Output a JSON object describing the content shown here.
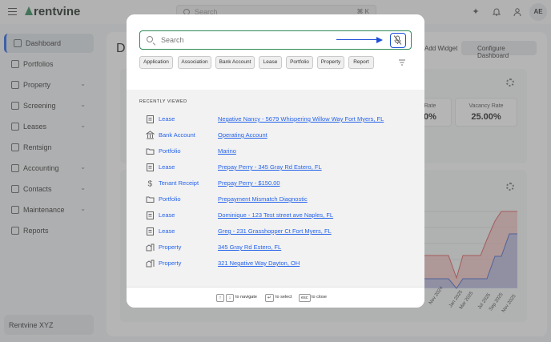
{
  "app": {
    "brand": "rentvine",
    "top_search": {
      "placeholder": "Search",
      "shortcut": "⌘ K"
    },
    "avatar_initials": "AE",
    "accent_color": "#2563eb",
    "brand_color": "#2e8b57"
  },
  "sidebar": {
    "items": [
      {
        "label": "Dashboard",
        "icon": "dashboard-icon",
        "active": true
      },
      {
        "label": "Portfolios",
        "icon": "folder-icon"
      },
      {
        "label": "Property",
        "icon": "building-icon",
        "expandable": true
      },
      {
        "label": "Screening",
        "icon": "clipboard-icon",
        "expandable": true
      },
      {
        "label": "Leases",
        "icon": "document-icon",
        "expandable": true
      },
      {
        "label": "Rentsign",
        "icon": "signature-icon"
      },
      {
        "label": "Accounting",
        "icon": "dollar-icon",
        "expandable": true
      },
      {
        "label": "Contacts",
        "icon": "book-icon",
        "expandable": true
      },
      {
        "label": "Maintenance",
        "icon": "wrench-icon",
        "expandable": true
      },
      {
        "label": "Reports",
        "icon": "chart-icon"
      }
    ],
    "workspace": "Rentvine XYZ"
  },
  "dashboard": {
    "title": "D",
    "add_widget": "Add Widget",
    "configure": "Configure Dashboard",
    "rate_label": "Rate",
    "rate_value": "0%",
    "vacancy_label": "Vacancy Rate",
    "vacancy_value": "25.00%",
    "month_labels": [
      "Nov 2024",
      "Jan 2025",
      "Mar 2025",
      "Jul 2025",
      "Sep 2025",
      "Nov 2025"
    ]
  },
  "modal": {
    "search_placeholder": "Search",
    "filters": [
      "Application",
      "Association",
      "Bank Account",
      "Lease",
      "Portfolio",
      "Property",
      "Report"
    ],
    "recent_header": "RECENTLY VIEWED",
    "recent": [
      {
        "type": "Lease",
        "icon": "clipboard-icon",
        "name": "Negative Nancy - 5679 Whispering Willow Way Fort Myers, FL"
      },
      {
        "type": "Bank Account",
        "icon": "bank-icon",
        "name": "Operating Account"
      },
      {
        "type": "Portfolio",
        "icon": "folder-icon",
        "name": "Marino"
      },
      {
        "type": "Lease",
        "icon": "clipboard-icon",
        "name": "Prepay Perry - 345 Gray Rd Estero, FL"
      },
      {
        "type": "Tenant Receipt",
        "icon": "dollar-icon",
        "name": "Prepay Perry - $150.00"
      },
      {
        "type": "Portfolio",
        "icon": "folder-icon",
        "name": "Prepayment Mismatch Diagnostic"
      },
      {
        "type": "Lease",
        "icon": "clipboard-icon",
        "name": "Dominique - 123 Test street ave Naples, FL"
      },
      {
        "type": "Lease",
        "icon": "clipboard-icon",
        "name": "Greg - 231 Grasshopper Ct Fort Myers, FL"
      },
      {
        "type": "Property",
        "icon": "building-icon",
        "name": "345 Gray Rd Estero, FL"
      },
      {
        "type": "Property",
        "icon": "building-icon",
        "name": "321 Negative Way Dayton, OH"
      }
    ],
    "footer": {
      "up_key": "↑",
      "down_key": "↓",
      "navigate": "to navigate",
      "enter_key": "↵",
      "select": "to select",
      "esc_key": "esc",
      "close": "to close"
    }
  }
}
